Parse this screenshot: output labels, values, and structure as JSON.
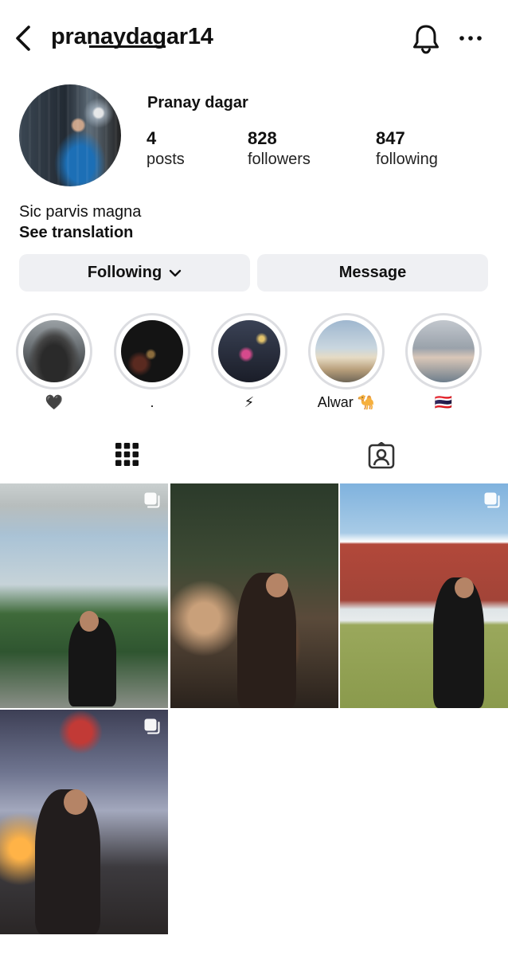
{
  "header": {
    "username": "pranaydagar14"
  },
  "profile": {
    "display_name": "Pranay dagar",
    "stats": [
      {
        "value": "4",
        "label": "posts"
      },
      {
        "value": "828",
        "label": "followers"
      },
      {
        "value": "847",
        "label": "following"
      }
    ],
    "bio": "Sic parvis magna",
    "see_translation": "See translation"
  },
  "actions": {
    "following_label": "Following",
    "message_label": "Message"
  },
  "highlights": [
    {
      "label": "🖤"
    },
    {
      "label": "."
    },
    {
      "label": "⚡"
    },
    {
      "label": "Alwar 🐪"
    },
    {
      "label": "🇹🇭"
    }
  ],
  "tabs": [
    {
      "name": "posts-grid",
      "icon": "grid-icon",
      "active": true
    },
    {
      "name": "tagged",
      "icon": "tagged-person-icon",
      "active": false
    }
  ],
  "icons": {
    "back": "chevron-left-icon",
    "notifications": "bell-icon",
    "more": "more-dots-icon",
    "multi_post": "multiple-photos-icon"
  },
  "colors": {
    "button_bg": "#eff0f3",
    "highlight_ring": "#dcdde1",
    "text": "#111111"
  }
}
